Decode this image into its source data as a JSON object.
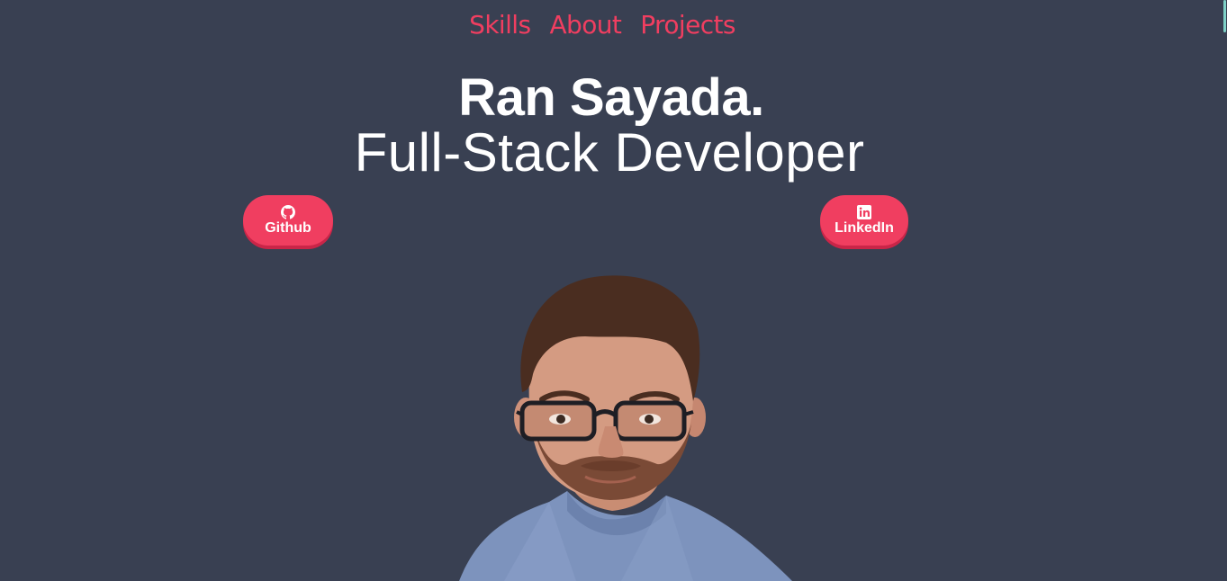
{
  "nav": {
    "items": [
      {
        "label": "Skills"
      },
      {
        "label": "About"
      },
      {
        "label": "Projects"
      }
    ]
  },
  "hero": {
    "name": "Ran Sayada.",
    "role": "Full-Stack Developer"
  },
  "social": {
    "github": {
      "label": "Github",
      "icon": "github-icon"
    },
    "linkedin": {
      "label": "LinkedIn",
      "icon": "linkedin-icon"
    }
  },
  "portrait": {
    "alt": "Ran Sayada"
  },
  "colors": {
    "background": "#394052",
    "accent": "#f03e60",
    "text": "#ffffff"
  }
}
